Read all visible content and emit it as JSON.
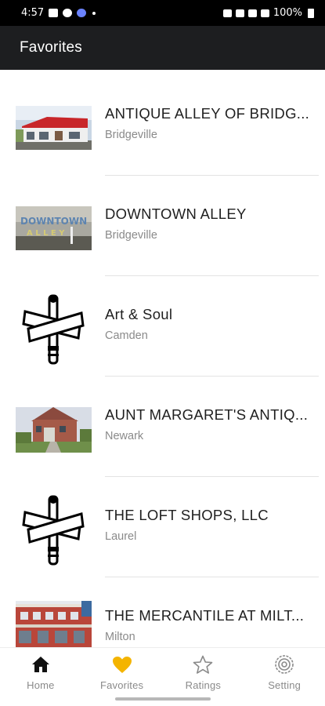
{
  "status_bar": {
    "time": "4:57",
    "battery": "100%"
  },
  "app_bar": {
    "title": "Favorites"
  },
  "favorites": [
    {
      "name": "ANTIQUE ALLEY OF BRIDG...",
      "city": "Bridgeville",
      "image": "storefront-photo"
    },
    {
      "name": "DOWNTOWN ALLEY",
      "city": "Bridgeville",
      "image": "sign-photo"
    },
    {
      "name": "Art & Soul",
      "city": "Camden",
      "image": "crossroads-sign-icon"
    },
    {
      "name": "AUNT MARGARET'S ANTIQ...",
      "city": "Newark",
      "image": "house-photo"
    },
    {
      "name": "THE LOFT SHOPS, LLC",
      "city": "Laurel",
      "image": "crossroads-sign-icon"
    },
    {
      "name": "THE MERCANTILE AT MILT...",
      "city": "Milton",
      "image": "brick-building-photo"
    }
  ],
  "bottom_nav": {
    "items": [
      {
        "label": "Home",
        "icon": "home-icon"
      },
      {
        "label": "Favorites",
        "icon": "heart-icon",
        "active": true
      },
      {
        "label": "Ratings",
        "icon": "star-icon"
      },
      {
        "label": "Setting",
        "icon": "target-icon"
      }
    ]
  },
  "colors": {
    "app_bar_bg": "#1d1e20",
    "status_bar_bg": "#000000",
    "active_accent": "#f4b400",
    "inactive_gray": "#8a8a8a",
    "home_icon": "#111111"
  }
}
